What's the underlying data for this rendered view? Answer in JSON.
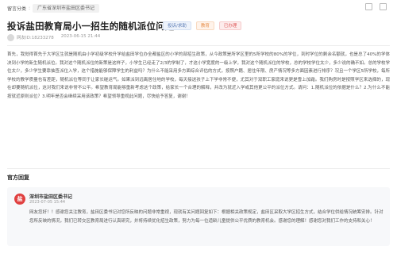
{
  "breadcrumb": {
    "prefix": "留言分类",
    "tag": "广东省深圳市盐田区委书记"
  },
  "post": {
    "title": "投诉盐田教育局小一招生的随机派位问题",
    "tags": [
      "投诉/求助",
      "教育",
      "已办理"
    ],
    "user_id": "网友ID:18233278",
    "datetime": "2023-06-15 21:44",
    "body": "首先，我觉得首先于大学区生就是随机由小学初级学校升学给盐田学位办全都盐区的小学的部招生政策，从今政策是所学区里的5所学校的80%的学位，到时学位的剩余名额就，也是总了40%的学体决到小学的新生随机派位。我对这个随机派位的新策是这样子，小学生已经走了2/3的学制了，才这小学宽度的一级上学，我对这个随机派位的学校，总的学校学位太少，多少说的确不如。总的学校学位太少，多少学生要靠抽签派位入学，这个措施能够保障学生的利益吗？为什么不能采用多方面综合评估的方式，按照户籍、居住年限、房产情况等多方面因素进行排序？况且一个学区5所学校，每所学校的教学质量也有差距，随机派位等同于让家长碰运气。如果派到远离居住地的学校，每天接送孩子上下学非常不便，尤其对于双职工家庭来说更是雪上加霜。我们购房时是按照学区来选择的，现在却要随机派位，这对我们来说非常不公平。希望教育局能够重新考虑这个政策，给家长一个合理的解释，并改为就近入学或其他更公平的派位方式。请问：1.随机派位的依据是什么？2.为什么不能按就近原则派位？3.明年是否会继续采用该政策？希望领导重视此问题，尽快给予答复，谢谢！",
    "views_label": ""
  },
  "official_reply": {
    "section_title": "官方回复",
    "org_name": "深圳市盐田区委书记",
    "date": "2023-07-05 15:44",
    "avatar_char": "盐",
    "text": "网友您好！！感谢您关注教育，盐田区委书记对您所反映的问题非常重视，现就有关问题回复如下：根据相关政策规定，盐田区采取大学区招生方式，结合学位供给情况统筹安排。针对您所反映的情况，我们已转交区教育局进行认真研究，并将持续优化招生政策，努力为每一位适龄儿童提供公平优质的教育机会。感谢您的理解！感谢您对我们工作的支持和关心！"
  }
}
